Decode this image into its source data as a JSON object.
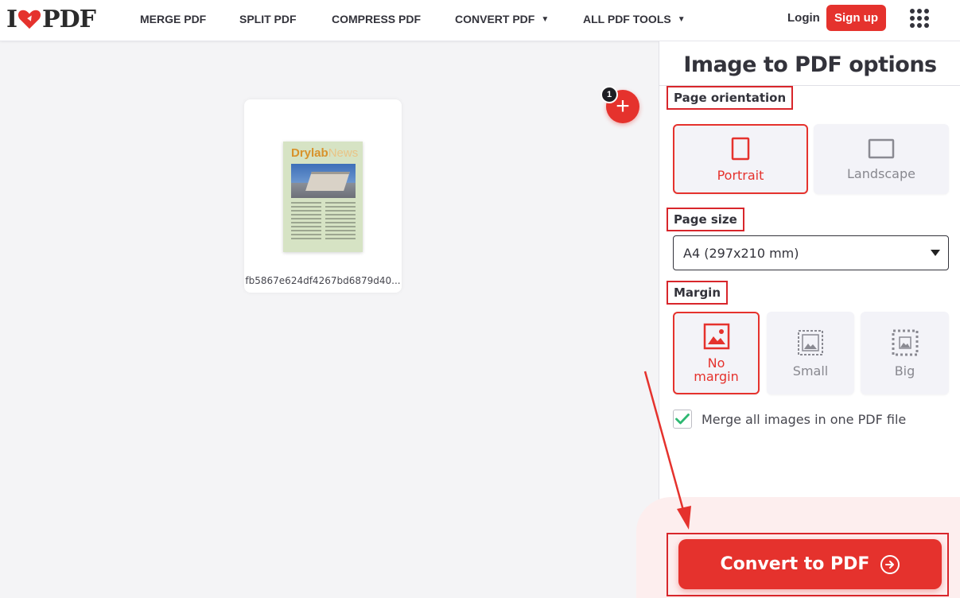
{
  "header": {
    "logo_left": "I",
    "logo_right": "PDF",
    "nav": [
      {
        "label": "MERGE PDF",
        "dropdown": false
      },
      {
        "label": "SPLIT PDF",
        "dropdown": false
      },
      {
        "label": "COMPRESS PDF",
        "dropdown": false
      },
      {
        "label": "CONVERT PDF",
        "dropdown": true
      },
      {
        "label": "ALL PDF TOOLS",
        "dropdown": true
      }
    ],
    "login": "Login",
    "signup": "Sign up"
  },
  "workspace": {
    "file": {
      "name": "fb5867e624df4267bd6879d40...",
      "thumb_title_bold": "Drylab",
      "thumb_title_light": "News"
    },
    "file_count_badge": "1",
    "add_icon": "+"
  },
  "sidebar": {
    "title": "Image to PDF options",
    "orientation": {
      "label": "Page orientation",
      "options": [
        "Portrait",
        "Landscape"
      ],
      "selected": "Portrait"
    },
    "page_size": {
      "label": "Page size",
      "value": "A4 (297x210 mm)"
    },
    "margin": {
      "label": "Margin",
      "options": [
        "No margin",
        "Small",
        "Big"
      ],
      "selected": "No margin"
    },
    "merge_checkbox": {
      "label": "Merge all images in one PDF file",
      "checked": true
    },
    "convert_button": "Convert to PDF"
  },
  "colors": {
    "brand": "#e5322d",
    "annotation": "#d8262b",
    "check": "#2eb872"
  }
}
